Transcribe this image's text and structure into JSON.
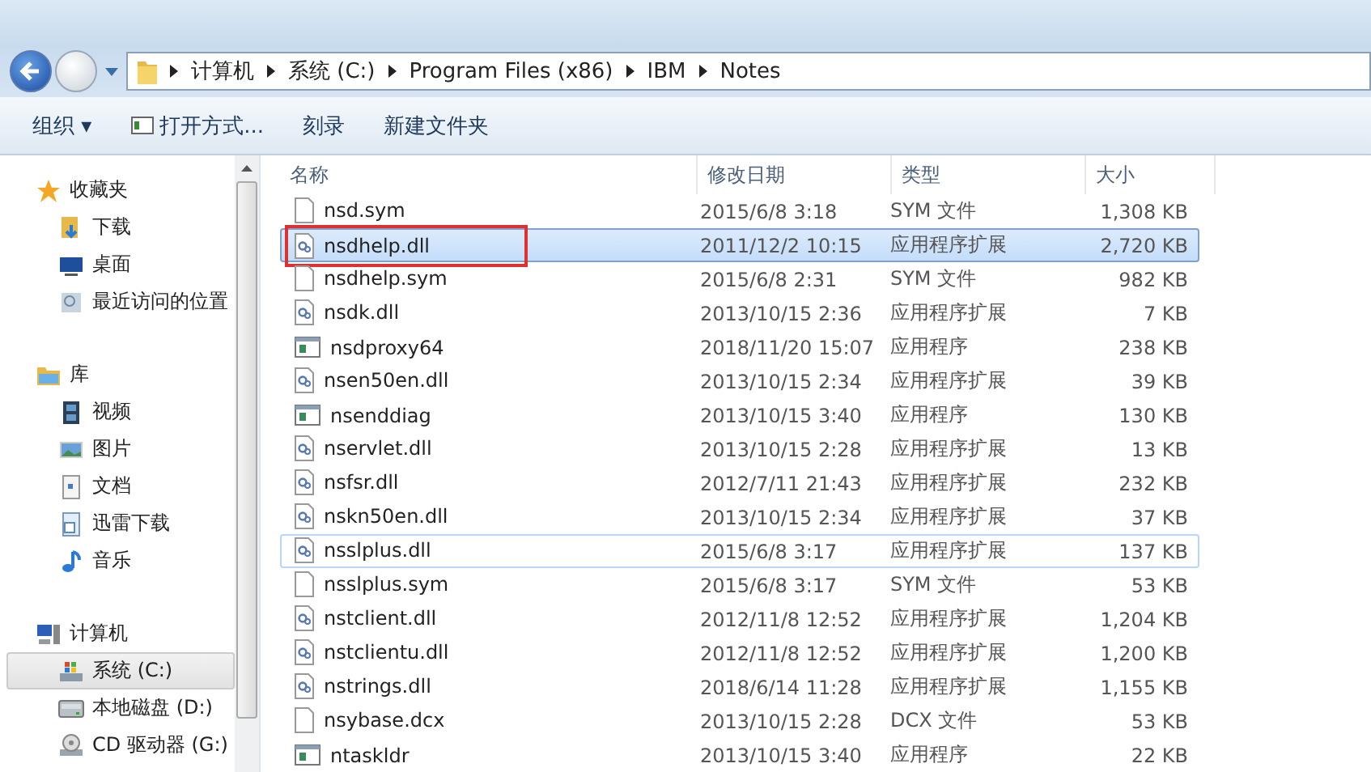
{
  "address_bar": {
    "crumbs": [
      "计算机",
      "系统 (C:)",
      "Program Files (x86)",
      "IBM",
      "Notes"
    ]
  },
  "toolbar": {
    "organize": "组织 ▾",
    "open_with": "打开方式...",
    "burn": "刻录",
    "new_folder": "新建文件夹"
  },
  "sidebar": {
    "groups": [
      {
        "kind": "favorites",
        "label": "收藏夹",
        "items": [
          {
            "kind": "download",
            "label": "下载",
            "selected": false
          },
          {
            "kind": "desktop",
            "label": "桌面",
            "selected": false
          },
          {
            "kind": "recent",
            "label": "最近访问的位置",
            "selected": false
          }
        ]
      },
      {
        "kind": "library",
        "label": "库",
        "items": [
          {
            "kind": "video",
            "label": "视频",
            "selected": false
          },
          {
            "kind": "image",
            "label": "图片",
            "selected": false
          },
          {
            "kind": "doc",
            "label": "文档",
            "selected": false
          },
          {
            "kind": "doc2",
            "label": "迅雷下载",
            "selected": false
          },
          {
            "kind": "music",
            "label": "音乐",
            "selected": false
          }
        ]
      },
      {
        "kind": "computer",
        "label": "计算机",
        "items": [
          {
            "kind": "sysdrive",
            "label": "系统 (C:)",
            "selected": true
          },
          {
            "kind": "drive",
            "label": "本地磁盘 (D:)",
            "selected": false
          },
          {
            "kind": "cd",
            "label": "CD 驱动器 (G:)",
            "selected": false
          }
        ]
      }
    ]
  },
  "table": {
    "columns": [
      "名称",
      "修改日期",
      "类型",
      "大小"
    ],
    "rows": [
      {
        "kind": "sym",
        "name": "nsd.sym",
        "date": "2015/6/8 3:18",
        "type": "SYM 文件",
        "size": "1,308 KB",
        "selected": false,
        "hovered": false,
        "marked": false
      },
      {
        "kind": "dll",
        "name": "nsdhelp.dll",
        "date": "2011/12/2 10:15",
        "type": "应用程序扩展",
        "size": "2,720 KB",
        "selected": true,
        "hovered": false,
        "marked": true
      },
      {
        "kind": "sym",
        "name": "nsdhelp.sym",
        "date": "2015/6/8 2:31",
        "type": "SYM 文件",
        "size": "982 KB",
        "selected": false,
        "hovered": false,
        "marked": false
      },
      {
        "kind": "dll",
        "name": "nsdk.dll",
        "date": "2013/10/15 2:36",
        "type": "应用程序扩展",
        "size": "7 KB",
        "selected": false,
        "hovered": false,
        "marked": false
      },
      {
        "kind": "exe",
        "name": "nsdproxy64",
        "date": "2018/11/20 15:07",
        "type": "应用程序",
        "size": "238 KB",
        "selected": false,
        "hovered": false,
        "marked": false
      },
      {
        "kind": "dll",
        "name": "nsen50en.dll",
        "date": "2013/10/15 2:34",
        "type": "应用程序扩展",
        "size": "39 KB",
        "selected": false,
        "hovered": false,
        "marked": false
      },
      {
        "kind": "exe",
        "name": "nsenddiag",
        "date": "2013/10/15 3:40",
        "type": "应用程序",
        "size": "130 KB",
        "selected": false,
        "hovered": false,
        "marked": false
      },
      {
        "kind": "dll",
        "name": "nservlet.dll",
        "date": "2013/10/15 2:28",
        "type": "应用程序扩展",
        "size": "13 KB",
        "selected": false,
        "hovered": false,
        "marked": false
      },
      {
        "kind": "dll",
        "name": "nsfsr.dll",
        "date": "2012/7/11 21:43",
        "type": "应用程序扩展",
        "size": "232 KB",
        "selected": false,
        "hovered": false,
        "marked": false
      },
      {
        "kind": "dll",
        "name": "nskn50en.dll",
        "date": "2013/10/15 2:34",
        "type": "应用程序扩展",
        "size": "37 KB",
        "selected": false,
        "hovered": false,
        "marked": false
      },
      {
        "kind": "dll",
        "name": "nsslplus.dll",
        "date": "2015/6/8 3:17",
        "type": "应用程序扩展",
        "size": "137 KB",
        "selected": false,
        "hovered": true,
        "marked": false
      },
      {
        "kind": "sym",
        "name": "nsslplus.sym",
        "date": "2015/6/8 3:17",
        "type": "SYM 文件",
        "size": "53 KB",
        "selected": false,
        "hovered": false,
        "marked": false
      },
      {
        "kind": "dll",
        "name": "nstclient.dll",
        "date": "2012/11/8 12:52",
        "type": "应用程序扩展",
        "size": "1,204 KB",
        "selected": false,
        "hovered": false,
        "marked": false
      },
      {
        "kind": "dll",
        "name": "nstclientu.dll",
        "date": "2012/11/8 12:52",
        "type": "应用程序扩展",
        "size": "1,200 KB",
        "selected": false,
        "hovered": false,
        "marked": false
      },
      {
        "kind": "dll",
        "name": "nstrings.dll",
        "date": "2018/6/14 11:28",
        "type": "应用程序扩展",
        "size": "1,155 KB",
        "selected": false,
        "hovered": false,
        "marked": false
      },
      {
        "kind": "sym",
        "name": "nsybase.dcx",
        "date": "2013/10/15 2:28",
        "type": "DCX 文件",
        "size": "53 KB",
        "selected": false,
        "hovered": false,
        "marked": false
      },
      {
        "kind": "exe",
        "name": "ntaskldr",
        "date": "2013/10/15 3:40",
        "type": "应用程序",
        "size": "22 KB",
        "selected": false,
        "hovered": false,
        "marked": false
      }
    ]
  }
}
